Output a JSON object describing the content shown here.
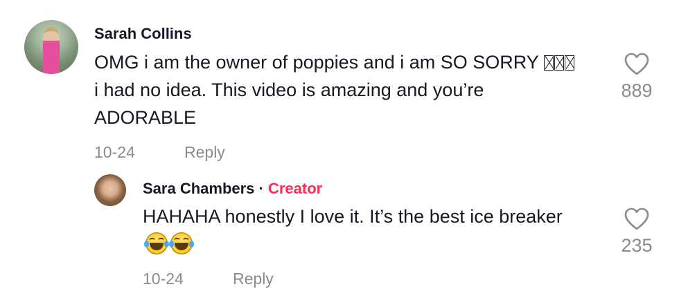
{
  "comment": {
    "author": "Sarah Collins",
    "text_before": "OMG i am the owner of poppies and i am SO SORRY ",
    "text_after": " i had no idea. This video is amazing and you’re ADORABLE",
    "date": "10-24",
    "reply_label": "Reply",
    "likes": "889",
    "like_icon": "heart-outline-icon"
  },
  "reply": {
    "author": "Sara Chambers",
    "separator": " · ",
    "creator_label": "Creator",
    "text": "HAHAHA honestly I love it. It’s the best ice breaker",
    "emojis": [
      "face-with-tears-of-joy",
      "face-with-tears-of-joy"
    ],
    "date": "10-24",
    "reply_label": "Reply",
    "likes": "235",
    "like_icon": "heart-outline-icon"
  },
  "colors": {
    "text": "#161823",
    "muted": "#8a8b91",
    "creator": "#fe2c55"
  }
}
